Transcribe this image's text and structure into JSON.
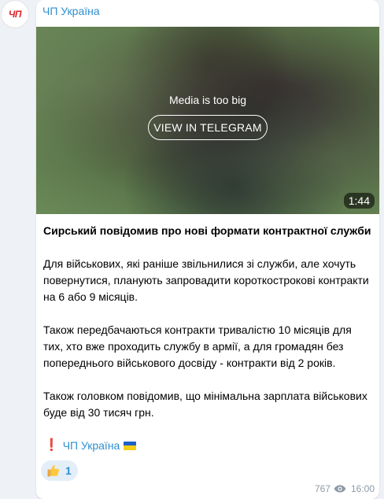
{
  "channel": {
    "name": "ЧП Україна",
    "avatar_text": "ЧП"
  },
  "media": {
    "notice": "Media is too big",
    "button_label": "VIEW IN TELEGRAM",
    "duration": "1:44"
  },
  "post": {
    "title": "Сирський повідомив про нові формати контрактної служби",
    "paragraphs": [
      "Для військових, які раніше звільнилися зі служби, але хочуть повернутися, планують запровадити короткострокові контракти на 6 або 9 місяців.",
      "Також передбачаються контракти тривалістю 10 місяців для тих, хто вже проходить службу в армії, а для громадян без попереднього військового досвіду - контракти від 2 років.",
      "Також головком повідомив, що мінімальна зарплата військових буде від 30 тисяч грн."
    ],
    "signature_mark": "❗",
    "signature_link": "ЧП Україна",
    "signature_flag": "ukraine-flag-icon"
  },
  "reaction": {
    "icon": "thumbs-up-icon",
    "count": "1"
  },
  "meta": {
    "views": "767",
    "views_icon": "eye-icon",
    "time": "16:00"
  },
  "colors": {
    "accent": "#2f8fd0",
    "avatar_red": "#e0242a",
    "flag_blue": "#1f5fc8",
    "flag_yellow": "#f4cf1a"
  }
}
